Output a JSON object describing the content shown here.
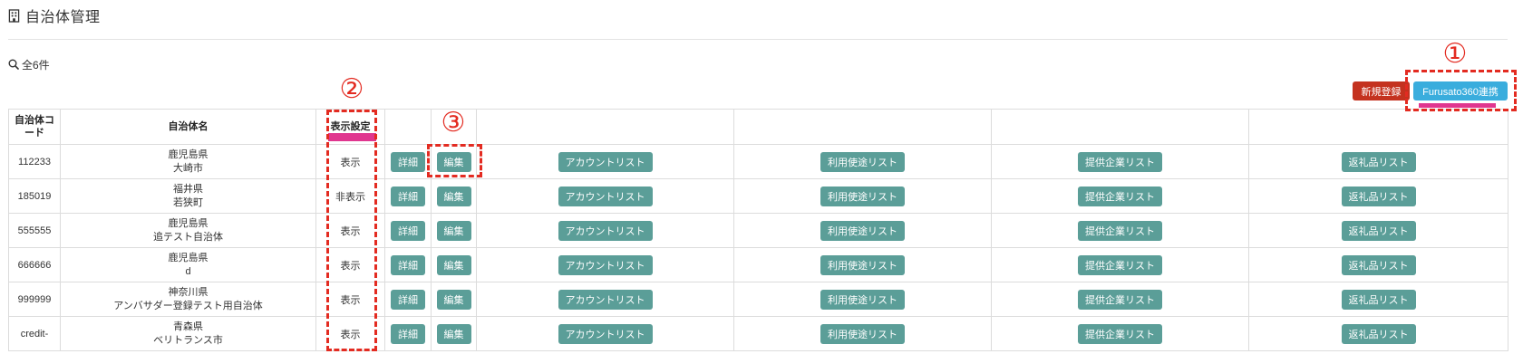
{
  "page": {
    "title": "自治体管理",
    "title_icon": "building-icon"
  },
  "summary": {
    "icon": "search-icon",
    "count_label": "全6件"
  },
  "actions": {
    "new_label": "新規登録",
    "sync_label": "Furusato360連携"
  },
  "table": {
    "headers": {
      "code": "自治体コード",
      "name": "自治体名",
      "visibility": "表示設定"
    },
    "buttons": {
      "detail": "詳細",
      "edit": "編集",
      "accounts": "アカウントリスト",
      "purposes": "利用使途リスト",
      "companies": "提供企業リスト",
      "gifts": "返礼品リスト"
    },
    "rows": [
      {
        "code": "112233",
        "prefecture": "鹿児島県",
        "city": "大崎市",
        "visibility": "表示"
      },
      {
        "code": "185019",
        "prefecture": "福井県",
        "city": "若狭町",
        "visibility": "非表示"
      },
      {
        "code": "555555",
        "prefecture": "鹿児島県",
        "city": "追テスト自治体",
        "visibility": "表示"
      },
      {
        "code": "666666",
        "prefecture": "鹿児島県",
        "city": "d",
        "visibility": "表示"
      },
      {
        "code": "999999",
        "prefecture": "神奈川県",
        "city": "アンバサダー登録テスト用自治体",
        "visibility": "表示"
      },
      {
        "code": "credit-",
        "prefecture": "青森県",
        "city": "ベリトランス市",
        "visibility": "表示"
      }
    ]
  },
  "annotations": [
    {
      "label": "①"
    },
    {
      "label": "②"
    },
    {
      "label": "③"
    }
  ],
  "colors": {
    "new_button": "#c4321f",
    "sync_button": "#3aaddd",
    "action_button": "#5b9e98",
    "annotation": "#e32b21",
    "highlight": "#e0368f"
  }
}
